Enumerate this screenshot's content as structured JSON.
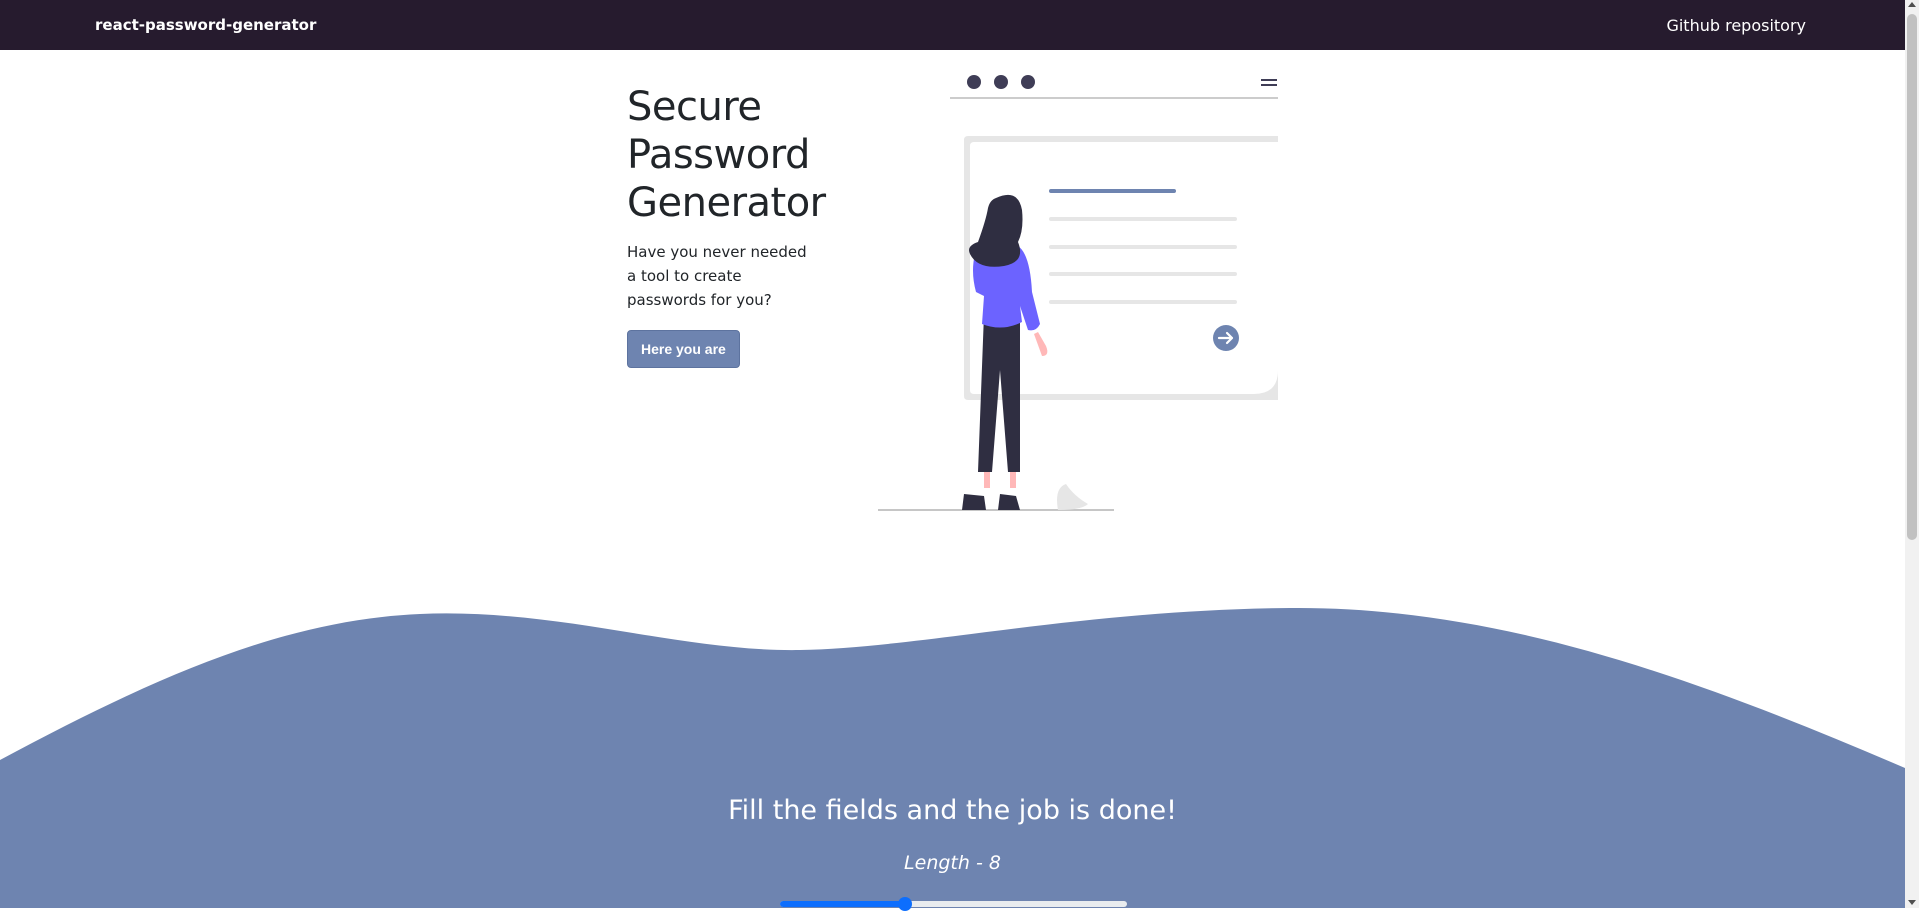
{
  "navbar": {
    "brand": "react-password-generator",
    "link": "Github repository"
  },
  "hero": {
    "title_line1": "Secure",
    "title_line2": "Password",
    "title_line3": "Generator",
    "subtitle": "Have you never needed a tool to create passwords for you?",
    "button_label": "Here you are"
  },
  "form": {
    "title": "Fill the fields and the job is done!",
    "length_label": "Length - 8",
    "length_value": 8,
    "length_fraction": 0.36
  },
  "colors": {
    "navbar_bg": "#261b2e",
    "accent": "#6e84b0",
    "figure_shirt": "#6c63ff",
    "slider": "#0d6efd"
  },
  "icons": [
    "hamburger-menu-icon",
    "arrow-right-circle-icon"
  ]
}
